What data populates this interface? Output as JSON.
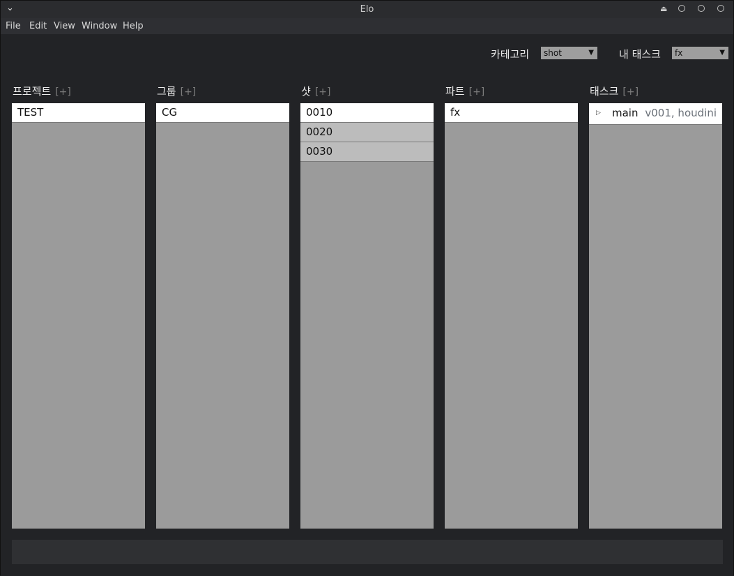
{
  "window": {
    "title": "Elo"
  },
  "menubar": {
    "items": [
      "File",
      "Edit",
      "View",
      "Window",
      "Help"
    ]
  },
  "filters": {
    "category_label": "카테고리",
    "category_value": "shot",
    "mytask_label": "내 태스크",
    "mytask_value": "fx"
  },
  "columns": {
    "project": {
      "title": "프로젝트",
      "add": "[+]",
      "items": [
        "TEST"
      ]
    },
    "group": {
      "title": "그룹",
      "add": "[+]",
      "items": [
        "CG"
      ]
    },
    "shot": {
      "title": "샷",
      "add": "[+]",
      "items": [
        "0010",
        "0020",
        "0030"
      ]
    },
    "part": {
      "title": "파트",
      "add": "[+]",
      "items": [
        "fx"
      ]
    },
    "task": {
      "title": "태스크",
      "add": "[+]",
      "items": [
        {
          "name": "main",
          "info": "v001, houdini"
        }
      ]
    }
  },
  "status": {
    "text": ""
  }
}
